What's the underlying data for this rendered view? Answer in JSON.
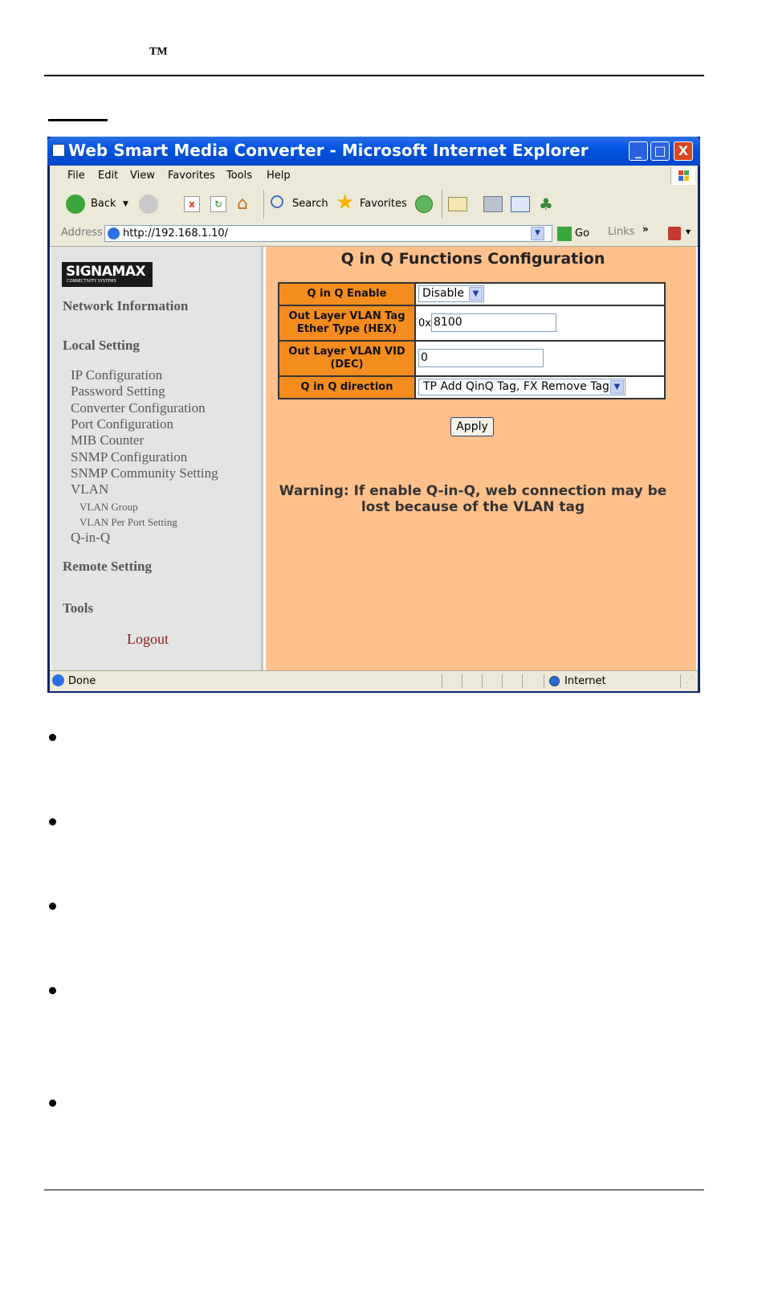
{
  "doc": {
    "tm": "TM"
  },
  "window": {
    "title": "Web Smart Media Converter - Microsoft Internet Explorer",
    "min": "_",
    "max": "□",
    "close": "X"
  },
  "menu": [
    "File",
    "Edit",
    "View",
    "Favorites",
    "Tools",
    "Help"
  ],
  "toolbar": {
    "back": "Back",
    "search": "Search",
    "favorites": "Favorites"
  },
  "address": {
    "label": "Address",
    "url": "http://192.168.1.10/",
    "go": "Go",
    "links": "Links"
  },
  "sidebar": {
    "logo": "SIGNAMAX",
    "logo_sub": "CONNECTIVITY SYSTEMS",
    "network_information": "Network Information",
    "local_setting": "Local Setting",
    "items": [
      "IP Configuration",
      "Password Setting",
      "Converter Configuration",
      "Port Configuration",
      "MIB Counter",
      "SNMP Configuration",
      "SNMP Community Setting",
      "VLAN"
    ],
    "subitems": [
      "VLAN Group",
      "VLAN Per Port Setting"
    ],
    "qinq": "Q-in-Q",
    "remote_setting": "Remote Setting",
    "tools": "Tools",
    "logout": "Logout"
  },
  "main": {
    "title": "Q in Q Functions Configuration",
    "rows": {
      "enable_label": "Q in Q Enable",
      "enable_value": "Disable",
      "ether_label_1": "Out Layer VLAN Tag",
      "ether_label_2": "Ether Type (HEX)",
      "ether_prefix": "0x",
      "ether_value": "8100",
      "vid_label_1": "Out Layer VLAN VID",
      "vid_label_2": "(DEC)",
      "vid_value": "0",
      "direction_label": "Q in Q direction",
      "direction_value": "TP Add QinQ Tag, FX Remove Tag"
    },
    "apply": "Apply",
    "warning_1": "Warning: If enable Q-in-Q, web connection may be",
    "warning_2": "lost because of the VLAN tag"
  },
  "status": {
    "left": "Done",
    "zone": "Internet"
  },
  "colors": {
    "nav_bg": "#e4e4e4",
    "main_bg": "#ffc08c",
    "label_bg": "#f58c1e",
    "xp_title": "#0054e3"
  }
}
